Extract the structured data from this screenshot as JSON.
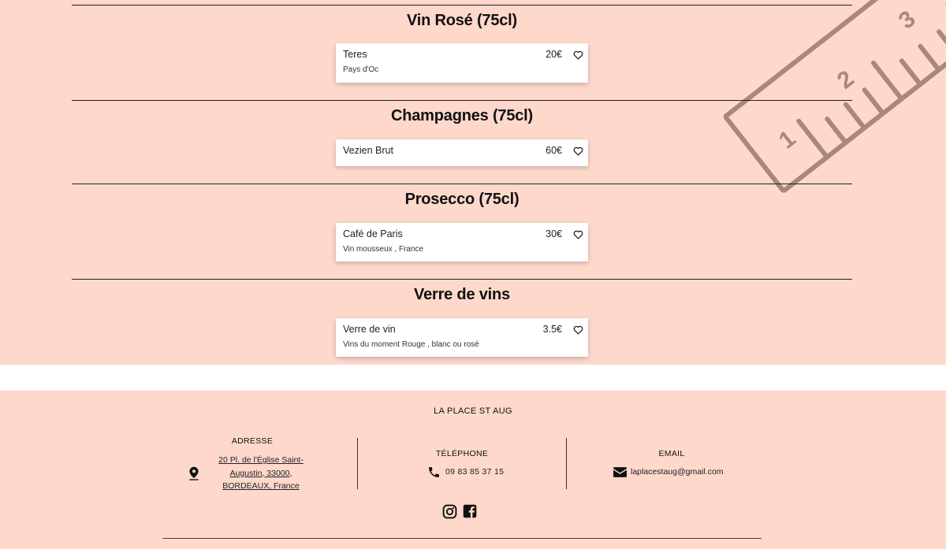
{
  "sections": [
    {
      "title": "Vin Rosé (75cl)",
      "items": [
        {
          "name": "Teres",
          "price": "20€",
          "description": "Pays d'Oc"
        }
      ]
    },
    {
      "title": "Champagnes (75cl)",
      "items": [
        {
          "name": "Vezien Brut",
          "price": "60€",
          "description": ""
        }
      ]
    },
    {
      "title": "Prosecco (75cl)",
      "items": [
        {
          "name": "Café de Paris",
          "price": "30€",
          "description": "Vin mousseux , France"
        }
      ]
    },
    {
      "title": "Verre de vins",
      "items": [
        {
          "name": "Verre de vin",
          "price": "3.5€",
          "description": "Vins du moment Rouge , blanc ou rosé"
        }
      ]
    }
  ],
  "footer": {
    "brand": "LA PLACE ST AUG",
    "address": {
      "title": "ADRESSE",
      "lines": [
        "20 Pl. de l'Église Saint-",
        "Augustin, 33000,",
        "BORDEAUX, France"
      ]
    },
    "phone": {
      "title": "TÉLÉPHONE",
      "value": "09 83 85 37 15"
    },
    "email": {
      "title": "EMAIL",
      "value": "laplacestaug@gmail.com"
    }
  },
  "decoration": {
    "ruler_numbers": [
      "1",
      "2",
      "3"
    ]
  },
  "colors": {
    "background": "#fdd8cb",
    "card": "#ffffff",
    "ruler": "#a8887c"
  },
  "icons": [
    "heart-icon",
    "location-pin-icon",
    "phone-icon",
    "envelope-icon",
    "instagram-icon",
    "facebook-icon"
  ]
}
